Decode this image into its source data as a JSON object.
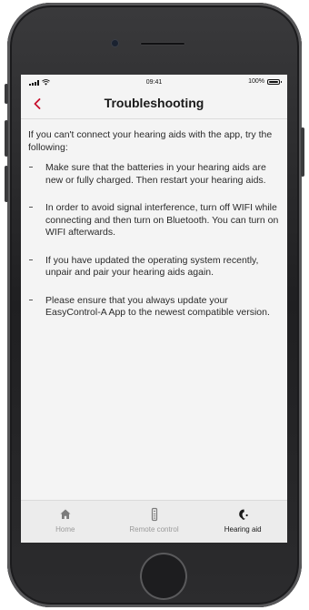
{
  "status_bar": {
    "time": "09:41",
    "battery_percent": "100%"
  },
  "nav": {
    "title": "Troubleshooting",
    "back_icon": "chevron-left-icon",
    "accent_color": "#c8102e"
  },
  "content": {
    "intro": "If you can't connect your hearing aids with the app, try the following:",
    "tips": [
      "Make sure that the batteries in your hearing aids are new or fully charged. Then restart your hearing aids.",
      "In order to avoid signal interference, turn off WIFI while connecting and then turn on Bluetooth. You can turn on WIFI afterwards.",
      "If you have updated the operating system recently, unpair and pair your hearing aids again.",
      "Please ensure that you always update your EasyControl-A App to the newest compatible version."
    ]
  },
  "tab_bar": {
    "tabs": [
      {
        "label": "Home",
        "icon": "home-icon",
        "active": false
      },
      {
        "label": "Remote control",
        "icon": "remote-control-icon",
        "active": false
      },
      {
        "label": "Hearing aid",
        "icon": "hearing-aid-icon",
        "active": true
      }
    ]
  }
}
